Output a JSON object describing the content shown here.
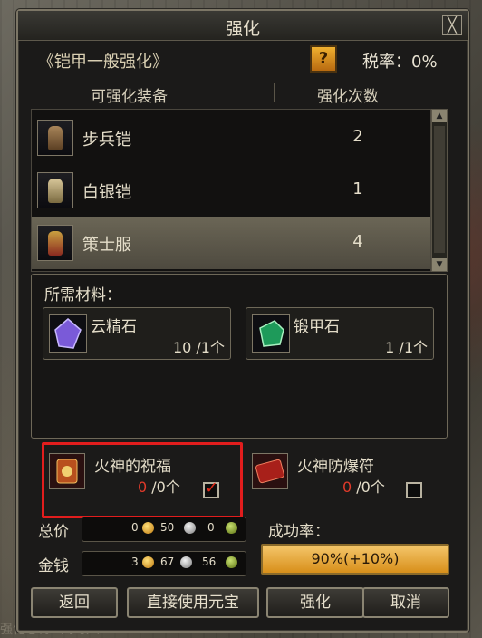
{
  "window": {
    "title": "强化",
    "close_label": "╳"
  },
  "header": {
    "mode_name": "《铠甲一般强化》",
    "help_label": "?",
    "tax_text": "税率：0%"
  },
  "columns": {
    "equipment": "可强化装备",
    "count": "强化次数"
  },
  "equipment": [
    {
      "name": "步兵铠",
      "count": "2",
      "icon": "infantry-armor-icon",
      "selected": false
    },
    {
      "name": "白银铠",
      "count": "1",
      "icon": "silver-armor-icon",
      "selected": false
    },
    {
      "name": "策士服",
      "count": "4",
      "icon": "strategist-robe-icon",
      "selected": true
    }
  ],
  "scroll": {
    "up": "▲",
    "down": "▼"
  },
  "materials": {
    "title": "所需材料：",
    "items": [
      {
        "name": "云精石",
        "qty": "10 /1个",
        "icon": "cloud-essence-stone-icon"
      },
      {
        "name": "锻甲石",
        "qty": "1 /1个",
        "icon": "forging-armor-stone-icon"
      }
    ]
  },
  "options": [
    {
      "name": "火神的祝福",
      "qty_have": "0",
      "qty_rest": " /0个",
      "checked": true,
      "icon": "fire-god-blessing-icon"
    },
    {
      "name": "火神防爆符",
      "qty_have": "0",
      "qty_rest": " /0个",
      "checked": false,
      "icon": "fire-god-charm-icon"
    }
  ],
  "cost": {
    "total_label": "总价",
    "total": {
      "gold": "0",
      "silver": "50",
      "copper": "0"
    },
    "money_label": "金钱",
    "money": {
      "gold": "3",
      "silver": "67",
      "copper": "56"
    }
  },
  "success": {
    "label": "成功率：",
    "value_text": "90%(+10%)",
    "rate": 90
  },
  "buttons": {
    "back": "返回",
    "use_ingot": "直接使用元宝",
    "enhance": "强化",
    "cancel": "取消"
  },
  "background_text": "强化心得（等级1）",
  "colors": {
    "accent_red": "#e21d1d",
    "rate_fill": "#f4c66a",
    "text": "#e4ddc9"
  }
}
